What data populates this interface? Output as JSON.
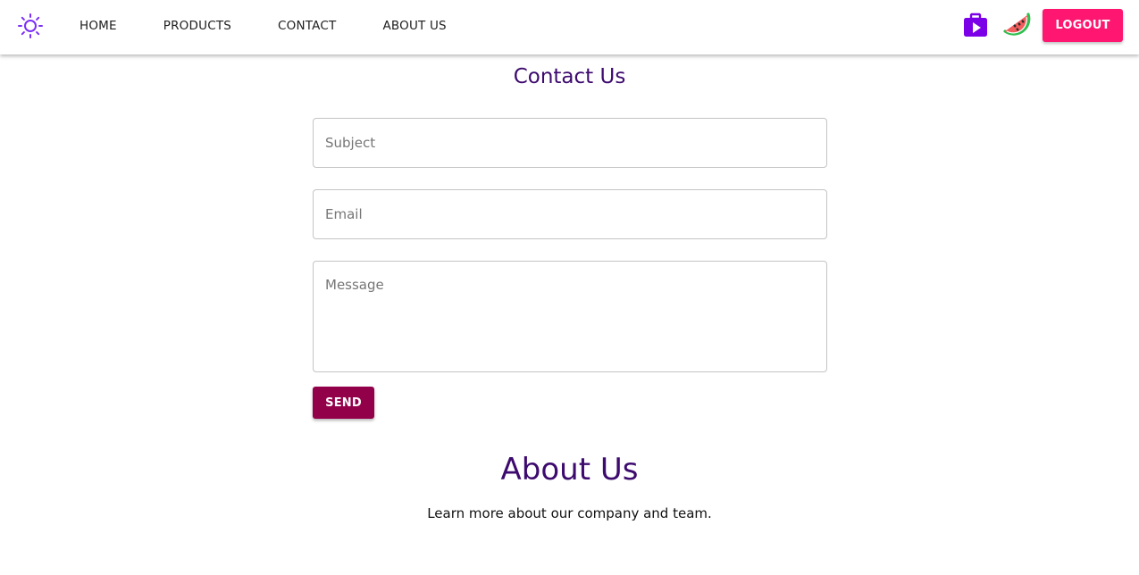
{
  "colors": {
    "accent": "#7b2ff7",
    "heading": "#3d0a6e",
    "logout": "#ff1670",
    "send": "#93004a"
  },
  "header": {
    "theme_icon": "sun-icon",
    "nav": [
      "HOME",
      "PRODUCTS",
      "CONTACT",
      "ABOUT US"
    ],
    "video_icon": "video-play-icon",
    "avatar_icon": "watermelon-avatar-icon",
    "logout_label": "LOGOUT"
  },
  "contact": {
    "title": "Contact Us",
    "subject_placeholder": "Subject",
    "email_placeholder": "Email",
    "message_placeholder": "Message",
    "send_label": "SEND"
  },
  "about": {
    "title": "About Us",
    "text": "Learn more about our company and team."
  }
}
